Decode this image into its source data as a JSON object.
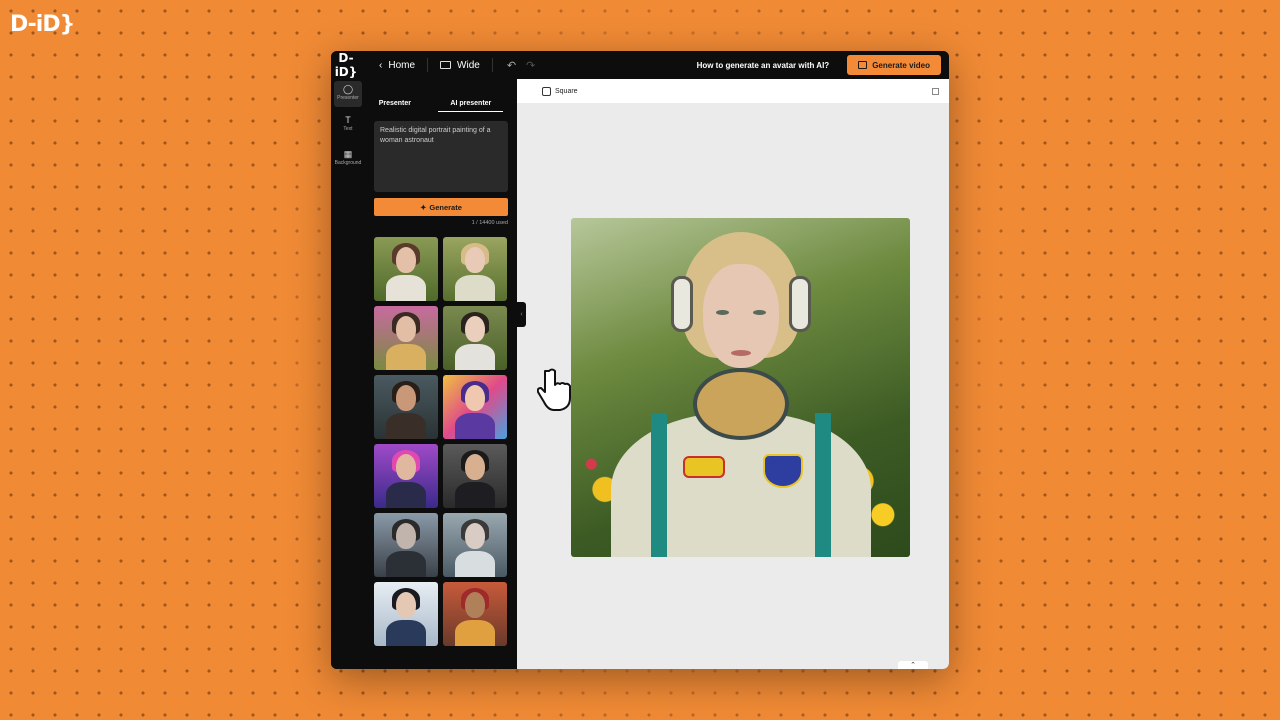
{
  "brand": {
    "logo_text": "D-iD}"
  },
  "topbar": {
    "logo_text": "D-iD}",
    "home_label": "Home",
    "wide_label": "Wide",
    "help_link": "How to generate an avatar with AI?",
    "generate_video_label": "Generate video"
  },
  "leftrail": {
    "items": [
      {
        "label": "Presenter",
        "icon": "person-icon",
        "active": true
      },
      {
        "label": "Text",
        "icon": "text-icon",
        "active": false
      },
      {
        "label": "Background",
        "icon": "grid-icon",
        "active": false
      }
    ]
  },
  "panel": {
    "tabs": [
      {
        "label": "Presenter",
        "active": false
      },
      {
        "label": "AI presenter",
        "active": true
      }
    ],
    "prompt_text": "Realistic digital portrait painting of a woman astronaut",
    "generate_label": "Generate",
    "usage_text": "1 / 14400 used"
  },
  "canvas": {
    "square_label": "Square"
  },
  "colors": {
    "accent": "#f28a38",
    "background": "#f08a35",
    "panel_bg": "#0d0d0d",
    "canvas_bg": "#ebebeb"
  }
}
